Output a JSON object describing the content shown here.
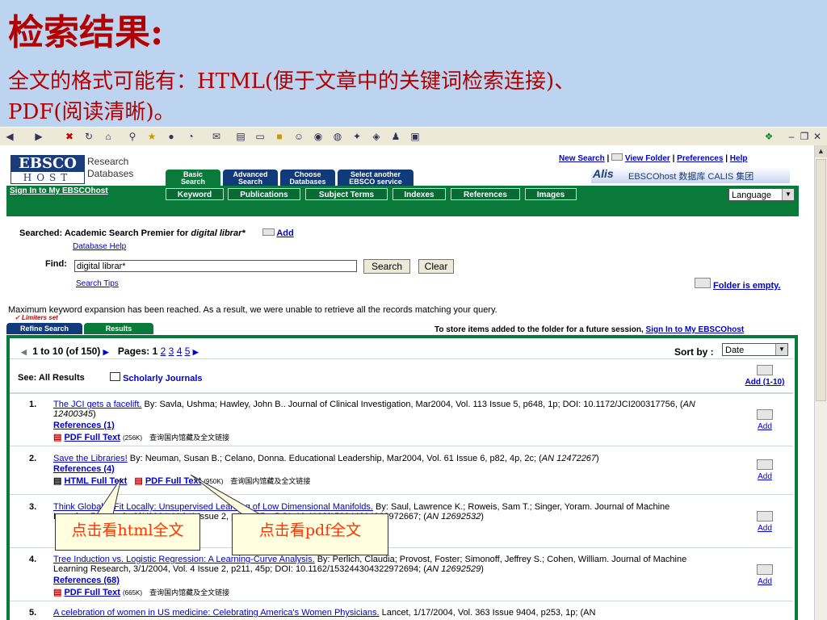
{
  "slide": {
    "title": "检索结果:",
    "line1": "全文的格式可能有：HTML(便于文章中的关键词检索连接)、",
    "line2": "PDF(阅读清晰)。"
  },
  "ebsco": {
    "logo_top": "EBSCO",
    "logo_bottom": "HOST",
    "brand_line1": "Research",
    "brand_line2": "Databases",
    "top_links": [
      "New Search",
      "View Folder",
      "Preferences",
      "Help"
    ],
    "calis": "EBSCOhost 数据库 CALIS 集团",
    "tabs": [
      {
        "l1": "Basic",
        "l2": "Search"
      },
      {
        "l1": "Advanced",
        "l2": "Search"
      },
      {
        "l1": "Choose",
        "l2": "Databases"
      },
      {
        "l1": "Select another",
        "l2": "EBSCO service"
      }
    ],
    "sign_in": "Sign In to My EBSCOhost",
    "subtabs": [
      "Keyword",
      "Publications",
      "Subject Terms",
      "Indexes",
      "References",
      "Images"
    ],
    "language": "Language",
    "searched_label": "Searched:",
    "searched_db": "Academic Search Premier for",
    "searched_term": "digital librar*",
    "add": "Add",
    "db_help": "Database Help",
    "find_label": "Find:",
    "find_value": "digital librar*",
    "search_btn": "Search",
    "clear_btn": "Clear",
    "search_tips": "Search Tips",
    "folder_empty": "Folder is empty.",
    "notice": "Maximum keyword expansion has been reached. As a result, we were unable to retrieve all the records matching your query.",
    "limiters": "✓ Limiters set",
    "refine_tab": "Refine Search",
    "results_tab": "Results",
    "store_text": "To store items added to the folder for a future session,",
    "store_link": "Sign In to My EBSCOhost",
    "range": "1 to 10",
    "of_total": "(of 150)",
    "pages_label": "Pages: 1",
    "pages": [
      "2",
      "3",
      "4",
      "5"
    ],
    "sort_label": "Sort by :",
    "sort_value": "Date",
    "see_label": "See: All Results",
    "scholarly": "Scholarly Journals",
    "add_range": "Add (1-10)",
    "library_note": "查询国内馆藏及全文链接",
    "results": [
      {
        "num": "1.",
        "title": "The JCI gets a facelift.",
        "rest": " By: Savla, Ushma; Hawley, John B.. Journal of Clinical Investigation, Mar2004, Vol. 113 Issue 5, p648, 1p; DOI: 10.1172/JCI200317756, (",
        "an": "AN 12400345",
        "refs": "References (1)",
        "pdf": "PDF Full Text",
        "pdf_size": "(256K)"
      },
      {
        "num": "2.",
        "title": "Save the Libraries!",
        "rest": " By: Neuman, Susan B.; Celano, Donna. Educational Leadership, Mar2004, Vol. 61 Issue 6, p82, 4p, 2c; (",
        "an": "AN 12472267",
        "refs": "References (4)",
        "html": "HTML Full Text",
        "pdf": "PDF Full Text",
        "pdf_size": "(950K)"
      },
      {
        "num": "3.",
        "title": "Think Globally, Fit Locally: Unsupervised Learning of Low Dimensional Manifolds.",
        "rest": " By: Saul, Lawrence K.; Roweis, Sam T.; Singer, Yoram. Journal of Machine Learning Research, 3/1/2004, Vol. 4 Issue 2, p119, 37p; DOI: 10.1162/153244304322972667; (",
        "an": "AN 12692532"
      },
      {
        "num": "4.",
        "title": "Tree Induction vs. Logistic Regression: A Learning-Curve Analysis.",
        "rest": " By: Perlich, Claudia; Provost, Foster; Simonoff, Jeffrey S.; Cohen, William. Journal of Machine Learning Research, 3/1/2004, Vol. 4 Issue 2, p211, 45p; DOI: 10.1162/153244304322972694; (",
        "an": "AN 12692529",
        "refs": "References (68)",
        "pdf": "PDF Full Text",
        "pdf_size": "(665K)"
      },
      {
        "num": "5.",
        "title": "A celebration of women in US medicine: Celebrating America's Women Physicians.",
        "rest": " Lancet, 1/17/2004, Vol. 363 Issue 9404, p253, 1p; (AN"
      }
    ]
  },
  "callouts": {
    "html": "点击看html全文",
    "pdf": "点击看pdf全文"
  }
}
